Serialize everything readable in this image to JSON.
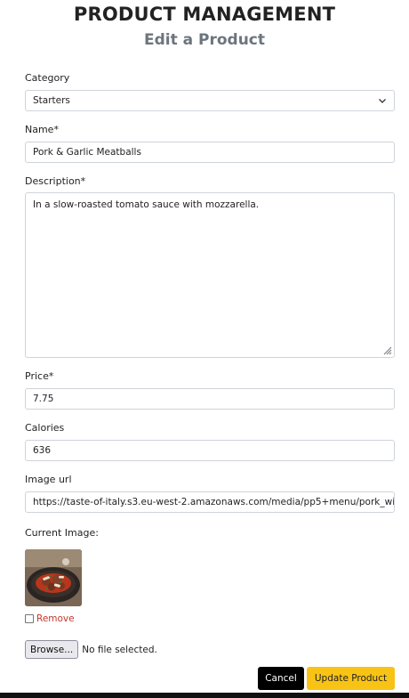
{
  "header": {
    "title": "PRODUCT MANAGEMENT",
    "subtitle": "Edit a Product"
  },
  "form": {
    "category": {
      "label": "Category",
      "value": "Starters"
    },
    "name": {
      "label": "Name*",
      "value": "Pork & Garlic Meatballs"
    },
    "description": {
      "label": "Description*",
      "value": "In a slow-roasted tomato sauce with mozzarella."
    },
    "price": {
      "label": "Price*",
      "value": "7.75"
    },
    "calories": {
      "label": "Calories",
      "value": "636"
    },
    "image_url": {
      "label": "Image url",
      "value": "https://taste-of-italy.s3.eu-west-2.amazonaws.com/media/pp5+menu/pork_wi"
    },
    "current_image": {
      "label": "Current Image:"
    },
    "remove": {
      "label": "Remove"
    },
    "file": {
      "button": "Browse...",
      "status": "No file selected."
    }
  },
  "actions": {
    "cancel": "Cancel",
    "update": "Update Product"
  }
}
